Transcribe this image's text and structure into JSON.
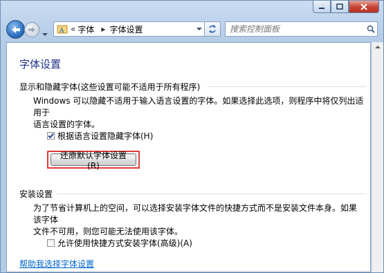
{
  "window": {
    "caption_buttons": [
      "minimize-icon",
      "maximize-icon",
      "close-icon"
    ]
  },
  "nav": {
    "breadcrumb_chevron": "«",
    "breadcrumb": [
      "字体",
      "字体设置"
    ],
    "search_placeholder": "搜索控制面板"
  },
  "page": {
    "title": "字体设置",
    "group1_header": "显示和隐藏字体(这些设置可能不适用于所有程序)",
    "group1_desc_line1": "Windows 可以隐藏不适用于输入语言设置的字体。如果选择此选项，则程序中将仅列出适用于",
    "group1_desc_line2": "语言设置的字体。",
    "hide_fonts_checkbox": {
      "label": "根据语言设置隐藏字体(H)",
      "checked": true
    },
    "restore_button": "还原默认字体设置(R)",
    "group2_header": "安装设置",
    "group2_desc_line1": "为了节省计算机上的空间，可以选择安装字体文件的快捷方式而不是安装文件本身。如果该字体",
    "group2_desc_line2": "文件不可用，则您可能无法使用该字体。",
    "shortcut_checkbox": {
      "label": "允许使用快捷方式安装字体(高级)(A)",
      "checked": false
    },
    "help_link": "帮助我选择字体设置"
  },
  "colors": {
    "title": "#1e3287",
    "link": "#0066cc",
    "highlight_border": "#e23a3a"
  }
}
